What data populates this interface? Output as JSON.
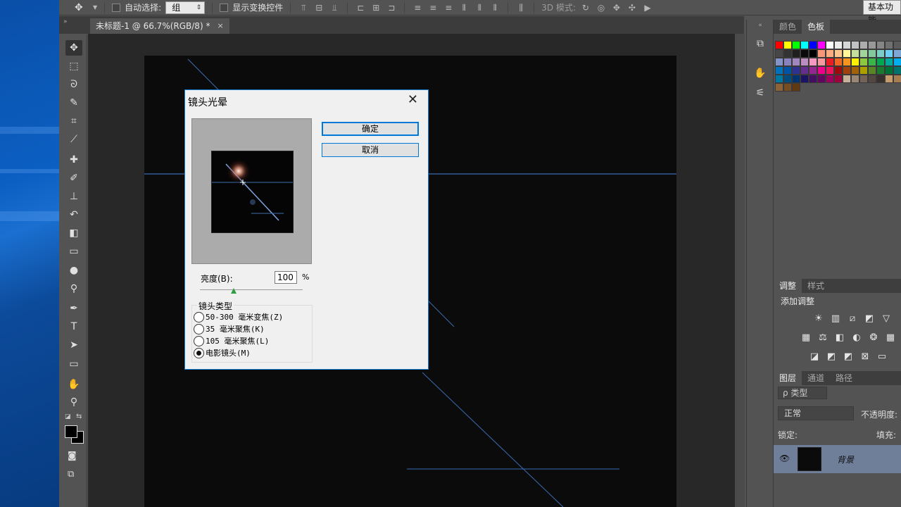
{
  "options_bar": {
    "auto_select_label": "自动选择:",
    "auto_select_value": "组",
    "show_transform_label": "显示变换控件",
    "mode_3d_label": "3D 模式:",
    "workspace_label": "基本功能"
  },
  "document_tab": {
    "title": "未标题-1 @ 66.7%(RGB/8) *",
    "close": "×"
  },
  "toolbar_tools": [
    {
      "name": "move-tool",
      "glyph": "✥"
    },
    {
      "name": "marquee-tool",
      "glyph": "⬚"
    },
    {
      "name": "lasso-tool",
      "glyph": "ᘐ"
    },
    {
      "name": "quick-select-tool",
      "glyph": "✎"
    },
    {
      "name": "crop-tool",
      "glyph": "⌗"
    },
    {
      "name": "eyedropper-tool",
      "glyph": "⟋"
    },
    {
      "name": "healing-tool",
      "glyph": "✚"
    },
    {
      "name": "brush-tool",
      "glyph": "✐"
    },
    {
      "name": "stamp-tool",
      "glyph": "⊥"
    },
    {
      "name": "history-brush-tool",
      "glyph": "↶"
    },
    {
      "name": "eraser-tool",
      "glyph": "◧"
    },
    {
      "name": "gradient-tool",
      "glyph": "▭"
    },
    {
      "name": "blur-tool",
      "glyph": "●"
    },
    {
      "name": "dodge-tool",
      "glyph": "⚲"
    },
    {
      "name": "pen-tool",
      "glyph": "✒"
    },
    {
      "name": "type-tool",
      "glyph": "T"
    },
    {
      "name": "path-select-tool",
      "glyph": "➤"
    },
    {
      "name": "shape-tool",
      "glyph": "▭"
    },
    {
      "name": "hand-tool",
      "glyph": "✋"
    },
    {
      "name": "zoom-tool",
      "glyph": "⚲"
    }
  ],
  "panels": {
    "swatch_tabs": [
      "颜色",
      "色板"
    ],
    "adjust_tabs": [
      "调整",
      "样式"
    ],
    "adjust_title": "添加调整",
    "layer_tabs": [
      "图层",
      "通道",
      "路径"
    ],
    "layer_filter": "ρ 类型",
    "blend_mode": "正常",
    "opacity_label": "不透明度:",
    "lock_label": "锁定:",
    "fill_label": "填充:",
    "layer_name": "背景"
  },
  "swatch_colors": [
    "#ff0000",
    "#ffff00",
    "#00ff00",
    "#00ffff",
    "#0000ff",
    "#ff00ff",
    "#ffffff",
    "#ebebeb",
    "#d6d6d6",
    "#c2c2c2",
    "#adadad",
    "#999999",
    "#858585",
    "#707070",
    "#5c5c5c",
    "#474747",
    "#333333",
    "#1f1f1f",
    "#0a0a0a",
    "#000000",
    "#f7977a",
    "#f9ad81",
    "#fdc68a",
    "#fff79a",
    "#c4df9b",
    "#a2d39c",
    "#82ca9d",
    "#7bcdc8",
    "#6ecff6",
    "#7ea7d8",
    "#8493ca",
    "#8882be",
    "#a187be",
    "#bc8dbf",
    "#f49ac2",
    "#f6989d",
    "#ed1c24",
    "#f26522",
    "#f7941d",
    "#fff200",
    "#8dc73f",
    "#39b54a",
    "#00a651",
    "#00a99d",
    "#00aeef",
    "#0072bc",
    "#0054a6",
    "#2e3192",
    "#662d91",
    "#92278f",
    "#ec008c",
    "#ed145b",
    "#9e0b0f",
    "#a0410d",
    "#a36209",
    "#aba000",
    "#598527",
    "#1a7b30",
    "#007236",
    "#00746b",
    "#0076a3",
    "#004b80",
    "#003471",
    "#1b1464",
    "#440e62",
    "#630460",
    "#9e005d",
    "#9e0039",
    "#c7b299",
    "#998675",
    "#736357",
    "#534741",
    "#37302d",
    "#c69c6d",
    "#a67c52",
    "#8c6239",
    "#754c24",
    "#603913"
  ],
  "dialog": {
    "title": "镜头光晕",
    "close": "✕",
    "ok_label": "确定",
    "cancel_label": "取消",
    "brightness_label": "亮度(B):",
    "brightness_value": "100",
    "brightness_unit": "%",
    "brightness_slider_fraction": 0.33,
    "lens_type_title": "镜头类型",
    "lens_options": [
      {
        "label": "50-300 毫米变焦(Z)",
        "selected": false
      },
      {
        "label": "35 毫米聚焦(K)",
        "selected": false
      },
      {
        "label": "105 毫米聚焦(L)",
        "selected": false
      },
      {
        "label": "电影镜头(M)",
        "selected": true
      }
    ]
  }
}
